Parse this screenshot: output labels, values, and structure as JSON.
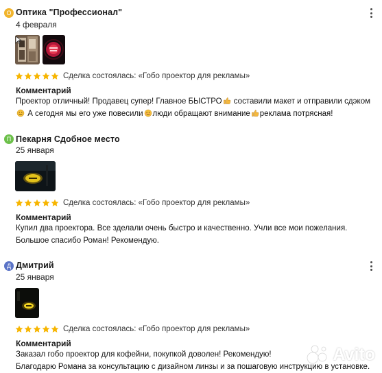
{
  "reviews": [
    {
      "avatar_letter": "О",
      "avatar_color": "#f1b42c",
      "author": "Оптика \"Профессионал\"",
      "date": "4 февраля",
      "deal": "Сделка состоялась: «Гобо проектор для рекламы»",
      "comment_title": "Комментарий",
      "rating": 5,
      "comment_parts": [
        "Проектор отличный! Продавец супер! Главное БЫСТРО",
        " составили макет и отправили сдэком ",
        " А сегодня мы его уже повесили",
        "люди обращают внимание",
        "реклама потрясная!"
      ]
    },
    {
      "avatar_letter": "П",
      "avatar_color": "#6cc04a",
      "author": "Пекарня Сдобное место",
      "date": "25 января",
      "deal": "Сделка состоялась: «Гобо проектор для рекламы»",
      "comment_title": "Комментарий",
      "rating": 5,
      "comment_lines": [
        "Купил два проектора. Все зделали очень быстро и качественно. Учли все мои пожелания.",
        "Большое спасибо Роман! Рекомендую."
      ]
    },
    {
      "avatar_letter": "Д",
      "avatar_color": "#5b74c7",
      "author": "Дмитрий",
      "date": "25 января",
      "deal": "Сделка состоялась: «Гобо проектор для рекламы»",
      "comment_title": "Комментарий",
      "rating": 5,
      "comment_lines": [
        "Заказал гобо проектор для кофейни, покупкой доволен! Рекомендую!",
        "Благодарю Романа за консультацию с дизайном линзы и за пошаговую инструкцию в установке."
      ]
    }
  ],
  "icons": {
    "star": "star-icon",
    "more": "more-vertical-icon",
    "emoji_thumb": "thumbs-up-emoji",
    "emoji_smile": "smile-emoji",
    "emoji_blush": "blush-emoji"
  },
  "colors": {
    "star": "#f7b500",
    "text": "#1a1a1a"
  },
  "watermark": "Avito"
}
